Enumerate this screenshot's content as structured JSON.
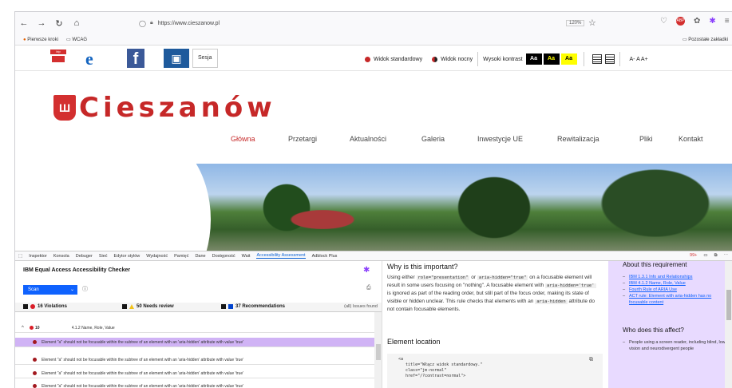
{
  "browser": {
    "url": "https://www.cieszanow.pl",
    "zoom": "120%",
    "bookmarks": [
      "Pierwsze kroki",
      "WCAG"
    ],
    "other_bookmarks": "Pozostałe zakładki"
  },
  "header": {
    "bip": "bip",
    "sesja": "Sesja",
    "view_standard": "Widok standardowy",
    "view_night": "Widok nocny",
    "high_contrast": "Wysoki kontrast",
    "contrast_options": [
      "Aa",
      "Aa",
      "Aa"
    ],
    "font_sizes": "A- A A+"
  },
  "site": {
    "brand": "Cieszanów",
    "nav": [
      "Główna",
      "Przetargi",
      "Aktualności",
      "Galeria",
      "Inwestycje UE",
      "Rewitalizacja",
      "Pliki",
      "Kontakt"
    ]
  },
  "devtools": {
    "tabs": [
      "Inspektor",
      "Konsola",
      "Debuger",
      "Sieć",
      "Edytor stylów",
      "Wydajność",
      "Pamięć",
      "Dane",
      "Dostępność",
      "Wait",
      "Accessibility Assessment",
      "Adblock Plus"
    ],
    "badge": "99+"
  },
  "checker": {
    "title": "IBM Equal Access Accessibility Checker",
    "scan": "Scan",
    "violations": "16 Violations",
    "needs_review": "50 Needs review",
    "recommendations": "37 Recommendations",
    "issues_found": "(all) Issues found",
    "group_label": "4.1.2 Name, Role, Value",
    "group_count": "10",
    "row_text": "Element \"a\" should not be focusable within the subtree of an element with an 'aria-hidden' attribute with value 'true'"
  },
  "detail": {
    "why_heading": "Why is this important?",
    "why_p1": "Using either",
    "code1": "role=\"presentation\"",
    "or": "or",
    "code2": "aria-hidden=\"true\"",
    "why_p2": "on a focusable element will result in some users focusing on \"nothing\". A focusable element with",
    "code3": "aria-hidden='true'",
    "why_p3": "is ignored as part of the reading order, but still part of the focus order, making its state of visible or hidden unclear. This rule checks that elements with an",
    "code4": "aria-hidden",
    "why_p4": "attribute do not contain focusable elements.",
    "location_heading": "Element location",
    "code_snippet": "<a\n   title=\"Włącz widok standardowy.\"\n   class=\"jm-normal\"\n   href=\"/?contrast=normal\">"
  },
  "requirement": {
    "about_heading": "About this requirement",
    "links": [
      "IBM 1.3.1 Info and Relationships",
      "IBM 4.1.2 Name, Role, Value",
      "Fourth Rule of ARIA Use",
      "ACT rule: Element with aria-hidden has no focusable content"
    ],
    "affect_heading": "Who does this affect?",
    "affect_items": [
      "People using a screen reader, including blind, low vision and neurodivergent people"
    ]
  }
}
